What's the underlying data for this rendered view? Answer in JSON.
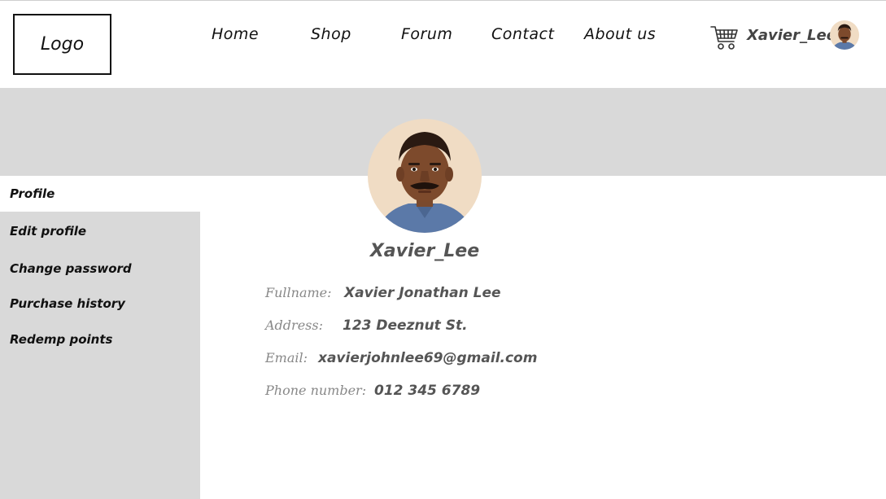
{
  "header": {
    "logo_text": "Logo",
    "nav": [
      {
        "label": "Home"
      },
      {
        "label": "Shop"
      },
      {
        "label": "Forum"
      },
      {
        "label": "Contact"
      },
      {
        "label": "About us"
      }
    ],
    "cart_icon": "shopping-cart-icon",
    "username": "Xavier_Lee"
  },
  "sidebar": {
    "items": [
      {
        "label": "Profile",
        "active": true
      },
      {
        "label": "Edit profile",
        "active": false
      },
      {
        "label": "Change password",
        "active": false
      },
      {
        "label": "Purchase history",
        "active": false
      },
      {
        "label": "Redemp points",
        "active": false
      }
    ]
  },
  "profile": {
    "username": "Xavier_Lee",
    "fields": [
      {
        "label": "Fullname:",
        "value": "Xavier Jonathan Lee"
      },
      {
        "label": "Address:",
        "value": "123 Deeznut St."
      },
      {
        "label": "Email:",
        "value": "xavierjohnlee69@gmail.com"
      },
      {
        "label": "Phone number:",
        "value": "012 345 6789"
      }
    ]
  },
  "colors": {
    "banner": "#d9d9d9",
    "sidebar": "#d9d9d9",
    "label": "#888888",
    "value": "#555555"
  }
}
